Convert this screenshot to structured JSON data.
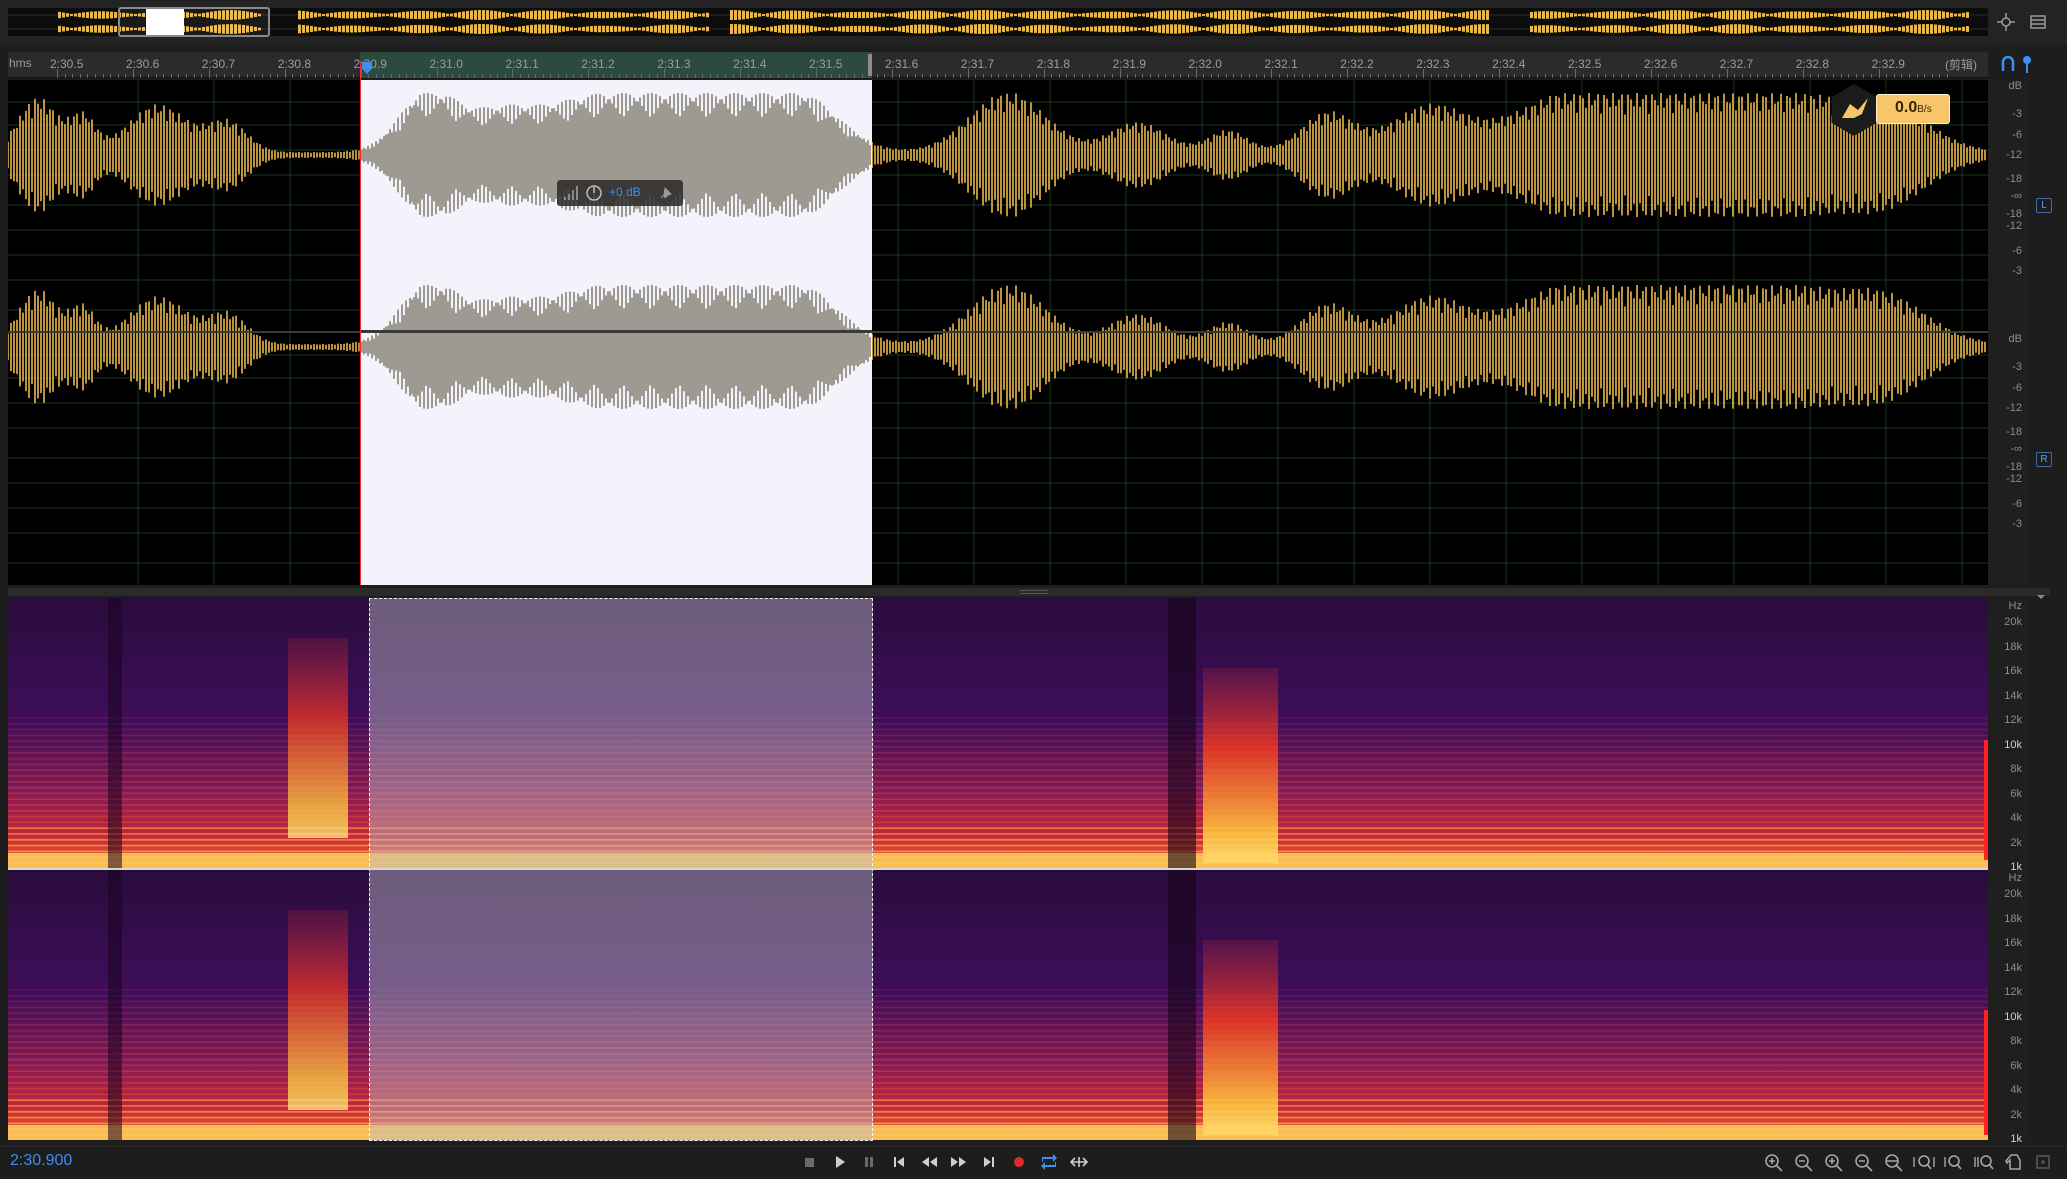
{
  "ruler": {
    "unit": "hms",
    "ticks": [
      "2:30.5",
      "2:30.6",
      "2:30.7",
      "2:30.8",
      "2:30.9",
      "2:31.0",
      "2:31.1",
      "2:31.2",
      "2:31.3",
      "2:31.4",
      "2:31.5",
      "2:31.6",
      "2:31.7",
      "2:31.8",
      "2:31.9",
      "2:32.0",
      "2:32.1",
      "2:32.2",
      "2:32.3",
      "2:32.4",
      "2:32.5",
      "2:32.6",
      "2:32.7",
      "2:32.8",
      "2:32.9"
    ],
    "right_label": "(剪辑)"
  },
  "waveform": {
    "db_scale_label": "dB",
    "db_ticks": [
      "-3",
      "-6",
      "-12",
      "-18",
      "-∞",
      "-18",
      "-12",
      "-6",
      "-3"
    ],
    "channels": [
      {
        "tag": "L"
      },
      {
        "tag": "R"
      }
    ],
    "hud": {
      "gain_value": "+0 dB",
      "icons": [
        "level-meter-icon",
        "knob-icon",
        "pin-icon"
      ]
    }
  },
  "speed_badge": {
    "value": "0.0",
    "unit": "B/s",
    "icon": "bird-icon"
  },
  "spectrogram": {
    "hz_scale_label": "Hz",
    "hz_ticks": [
      "20k",
      "18k",
      "16k",
      "14k",
      "12k",
      "10k",
      "8k",
      "6k",
      "4k",
      "2k",
      "1k"
    ]
  },
  "transport": {
    "time": "2:30.900",
    "buttons": [
      "stop-icon",
      "play-icon",
      "pause-icon",
      "goto-start-icon",
      "rewind-icon",
      "fast-forward-icon",
      "goto-end-icon",
      "record-icon",
      "loop-icon",
      "skip-selection-icon"
    ]
  },
  "zoom_tools": [
    "zoom-in-amplitude-icon",
    "zoom-out-amplitude-icon",
    "zoom-in-icon",
    "zoom-out-icon",
    "zoom-full-icon",
    "zoom-in-selection-icon",
    "zoom-in-left-icon",
    "zoom-in-right-icon",
    "zoom-out-full-icon",
    "hand-tool-icon",
    "zoom-extra-icon"
  ],
  "colors": {
    "waveform": "#e9b84a",
    "selection_wave": "#4a3f27",
    "selection_bg": "#f3f4fb",
    "playhead": "#3b90f0",
    "selection_start": "#ff2a2a",
    "time_display": "#3d8ff0",
    "speed_box": "#f7c66a"
  }
}
